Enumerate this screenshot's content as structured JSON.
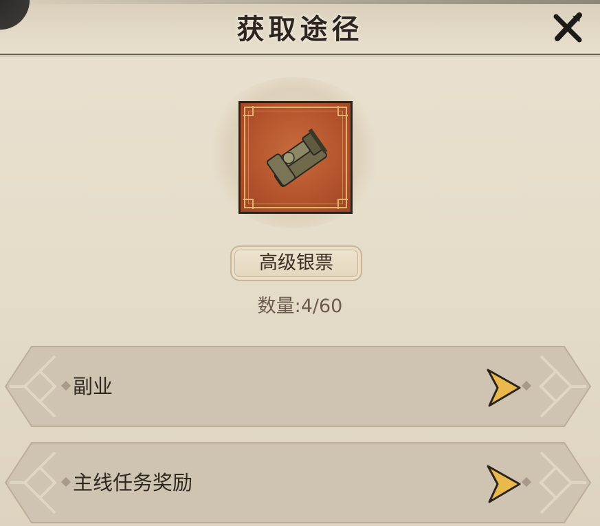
{
  "dialog": {
    "title": "获取途径"
  },
  "item": {
    "name": "高级银票",
    "quantity_text": "数量:4/60"
  },
  "sources": [
    {
      "label": "副业"
    },
    {
      "label": "主线任务奖励"
    }
  ],
  "colors": {
    "item_background": "#b3532c",
    "frame_gold": "#e0b36b",
    "row_fill": "#cfc4b1",
    "arrow_gold": "#e9b94c"
  },
  "icons": {
    "close": "close-icon",
    "item": "ticket-icon",
    "arrow": "chevron-right-icon"
  }
}
